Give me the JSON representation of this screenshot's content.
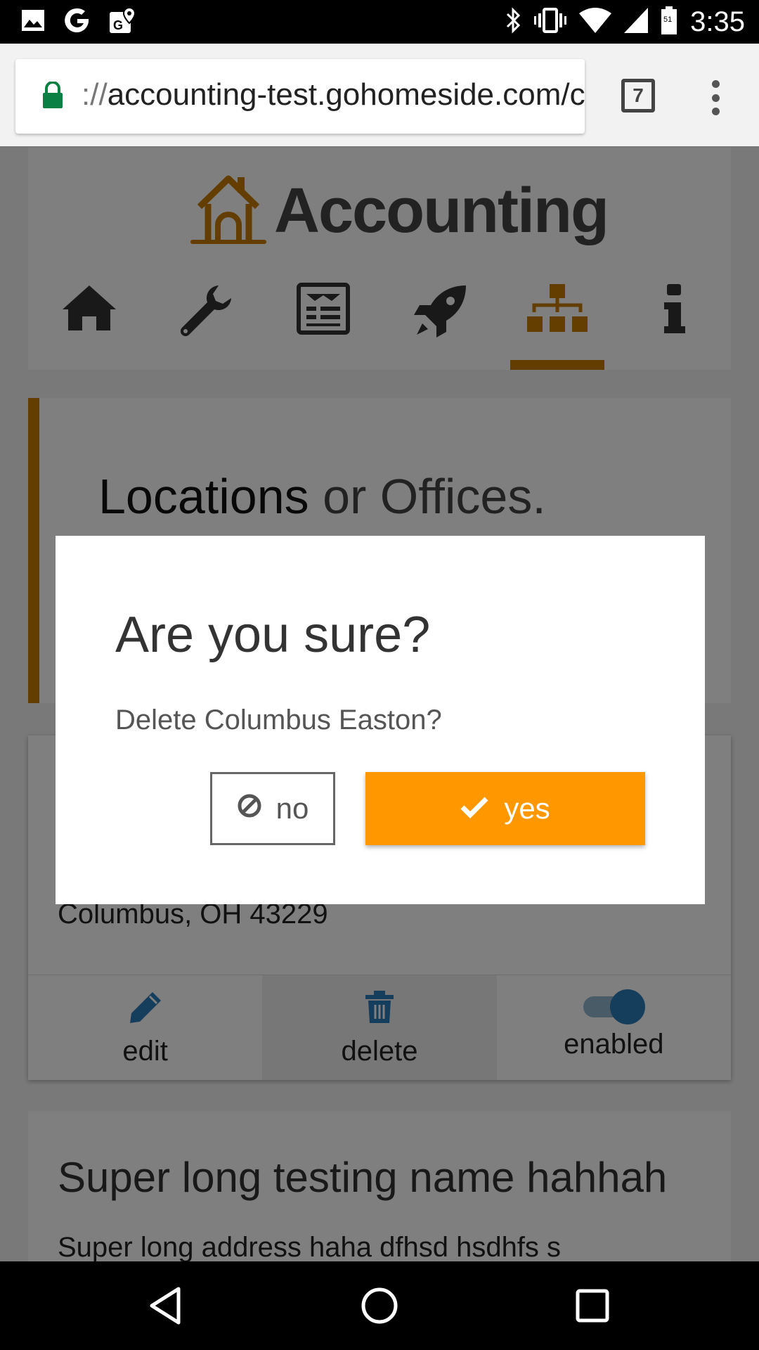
{
  "status_bar": {
    "time": "3:35",
    "left_icons": [
      "image-icon",
      "google-icon",
      "maps-icon"
    ],
    "right_icons": [
      "bluetooth-icon",
      "vibrate-icon",
      "wifi-icon",
      "signal-icon",
      "battery-icon"
    ]
  },
  "browser": {
    "url_scheme": "://",
    "url_text": "accounting-test.gohomeside.com/c",
    "tab_count": "7"
  },
  "header": {
    "brand": "Accounting",
    "nav_items": [
      "home-icon",
      "wrench-icon",
      "newspaper-icon",
      "rocket-icon",
      "sitemap-icon",
      "info-icon"
    ],
    "active_nav": "sitemap-icon"
  },
  "page": {
    "title_main": "Locations",
    "title_rest": " or Offices."
  },
  "location_card": {
    "address_line": "Columbus, OH 43229",
    "actions": {
      "edit": "edit",
      "delete": "delete",
      "enabled": "enabled"
    },
    "enabled_state": true
  },
  "location_card_2": {
    "name": "Super long testing name hahhah",
    "address": "Super long address haha dfhsd hsdhfs s"
  },
  "dialog": {
    "title": "Are you sure?",
    "message": "Delete Columbus Easton?",
    "no_label": "no",
    "yes_label": "yes"
  },
  "colors": {
    "accent": "#c87a00",
    "yes_button": "#ff9800",
    "toggle": "#2b7bb9"
  }
}
